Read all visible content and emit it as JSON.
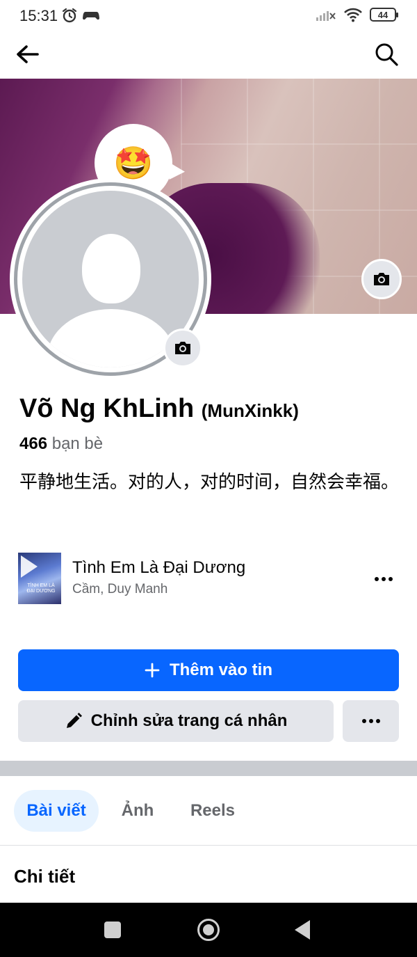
{
  "status_bar": {
    "time": "15:31",
    "battery": "44",
    "icons": [
      "alarm-icon",
      "game-controller-icon",
      "signal-off-icon",
      "wifi-icon",
      "battery-icon"
    ]
  },
  "top_nav": {
    "icons": [
      "back-arrow-icon",
      "search-icon"
    ]
  },
  "profile": {
    "name": "Võ Ng KhLinh",
    "nickname": "(MunXinkk)",
    "friends_count": "466",
    "friends_label": "bạn bè",
    "bio": "平静地生活。对的人，对的时间，自然会幸福。",
    "status_emoji": "🤩"
  },
  "music": {
    "title": "Tình Em Là Đại Dương",
    "artist": "Cầm, Duy Manh",
    "art_text": "TÌNH EM LÀ ĐẠI DƯƠNG"
  },
  "actions": {
    "add_story_label": "Thêm vào tin",
    "edit_profile_label": "Chỉnh sửa trang cá nhân"
  },
  "tabs": [
    {
      "label": "Bài viết",
      "active": true
    },
    {
      "label": "Ảnh",
      "active": false
    },
    {
      "label": "Reels",
      "active": false
    }
  ],
  "details_heading": "Chi tiết",
  "colors": {
    "primary": "#0866ff",
    "secondary_button": "#e4e6eb",
    "active_tab_bg": "#e7f3ff",
    "muted_text": "#65676b"
  }
}
